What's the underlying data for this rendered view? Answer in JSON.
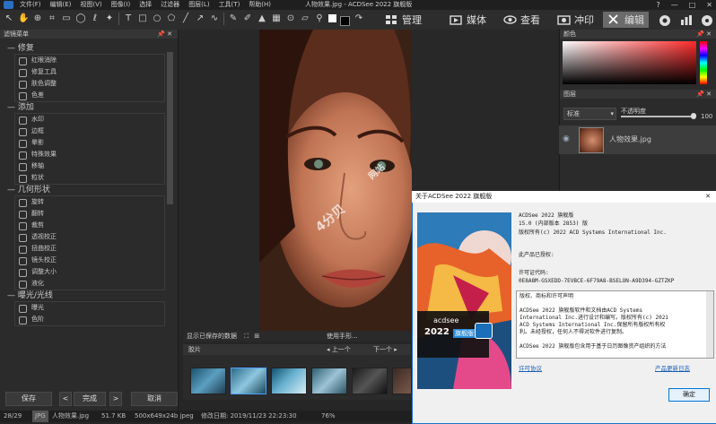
{
  "app": {
    "title": "人物效果.jpg - ACDSee 2022 旗舰版",
    "menu": [
      "文件(F)",
      "编辑(E)",
      "视图(V)",
      "图像(I)",
      "选择",
      "过滤器",
      "图层(L)",
      "工具(T)",
      "帮助(H)"
    ],
    "window_controls": [
      "?",
      "—",
      "□",
      "✕"
    ]
  },
  "modes": [
    {
      "label": "管理",
      "icon": "grid-icon"
    },
    {
      "label": "媒体",
      "icon": "media-icon"
    },
    {
      "label": "查看",
      "icon": "eye-icon"
    },
    {
      "label": "冲印",
      "icon": "develop-icon"
    },
    {
      "label": "编辑",
      "icon": "edit-icon"
    },
    {
      "label": "",
      "icon": "360-icon"
    },
    {
      "label": "",
      "icon": "dashboard-icon"
    },
    {
      "label": "",
      "icon": "more-icon"
    }
  ],
  "left_panel": {
    "header": "滤镜菜单",
    "pin": "📌 ✕",
    "sections": [
      {
        "title": "修复",
        "items": [
          "红眼消除",
          "修复工具",
          "肤色调整",
          "色差"
        ]
      },
      {
        "title": "添加",
        "items": [
          "水印",
          "边框",
          "晕影",
          "特殊效果",
          "移轴",
          "粒状"
        ]
      },
      {
        "title": "几何形状",
        "items": [
          "旋转",
          "翻转",
          "裁剪",
          "透视校正",
          "扭曲校正",
          "镜头校正",
          "调整大小",
          "液化"
        ]
      },
      {
        "title": "曝光/光线",
        "items": [
          "曝光",
          "色阶"
        ]
      }
    ],
    "buttons": {
      "save": "保存",
      "prev": "<",
      "done": "完成",
      "next": ">",
      "cancel": "取消"
    }
  },
  "view_bar": {
    "text": "显示已保存的数据",
    "mode": "使用手形..."
  },
  "filmstrip": {
    "header": "胶片",
    "prev": "上一个",
    "next": "下一个"
  },
  "right_panel": {
    "color_header": "颜色",
    "layers_header": "图层",
    "blend_mode": "标准",
    "opacity_label": "不透明度",
    "opacity_value": "100",
    "layer_name": "人物效果.jpg"
  },
  "status_bar": {
    "index": "28/29",
    "format": "JPG",
    "filename": "人物效果.jpg",
    "filesize": "51.7 KB",
    "dimensions": "500x649x24b jpeg",
    "modified": "修改日期: 2019/11/23 22:23:30",
    "zoom": "76%"
  },
  "watermark": {
    "line1": "4分贝",
    "line2": "网站"
  },
  "dialog": {
    "title": "关于ACDSee 2022 旗舰版",
    "close": "✕",
    "brand": "acdsee",
    "edition_year": "2022",
    "edition_name": "旗舰版",
    "product": "ACDSee 2022 旗舰版",
    "version": "15.0 (内部版本 2853) 版",
    "copyright": "版权所有(c) 2022 ACD Systems International Inc.",
    "licensed": "此产品已授权:",
    "license_code_label": "许可证代码:",
    "license_code": "0E8A8M-GSXEDD-7EVBCE-6F79A8-BSELON-A9D394-GZTZKP",
    "license_box_title": "版权、商标和许可声明",
    "license_text": [
      "ACDSee 2022 旗舰版软件和文档由ACD Systems",
      "International Inc.进行设计和编写。版权所有(c) 2021",
      "ACD Systems International Inc.保留所有版权所有权",
      "利。未经授权，任何人不得对软件进行复制。",
      "",
      "ACDSee 2022 旗舰版包含用于基于日历图像资产组织的方法"
    ],
    "license_link": "许可协议",
    "update_link": "产品更新日志",
    "ok": "确定"
  }
}
